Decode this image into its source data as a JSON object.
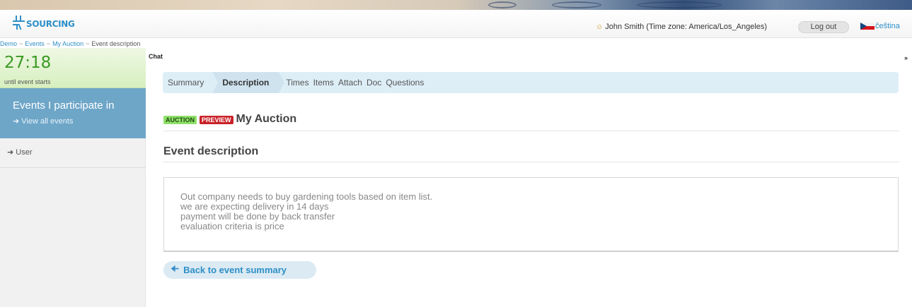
{
  "header": {
    "logo_text": "SOURCING",
    "user_text": "John Smith (Time zone: America/Los_Angeles)",
    "logout_label": "Log out",
    "language_label": "čeština"
  },
  "breadcrumb": {
    "items": [
      "Demo",
      "Events",
      "My Auction"
    ],
    "current": "Event description",
    "separator": "~"
  },
  "sidebar": {
    "timer": "27:18",
    "timer_caption": "until event starts",
    "events_title": "Events I participate in",
    "events_link": "View all events",
    "user_link": "User"
  },
  "chat": {
    "label": "Chat",
    "toggle": "»"
  },
  "tabs": {
    "items": [
      "Summary",
      "Description",
      "Times",
      "Items",
      "Attach",
      "Doc",
      "Questions"
    ],
    "active": "Description"
  },
  "event": {
    "badge_auction": "AUCTION",
    "badge_preview": "PREVIEW",
    "title": "My Auction",
    "section_title": "Event description",
    "description_lines": [
      "Out company needs to buy gardening tools based on item list.",
      "we are expecting delivery in 14 days",
      "payment will be done by back transfer",
      "evaluation criteria is price"
    ],
    "back_label": "Back to event summary"
  },
  "colors": {
    "brand_blue": "#2e8fc7",
    "timer_green": "#3a9a23",
    "sidebar_blue": "#6ea6c8",
    "preview_red": "#c9222a",
    "auction_green": "#8fe06a"
  }
}
